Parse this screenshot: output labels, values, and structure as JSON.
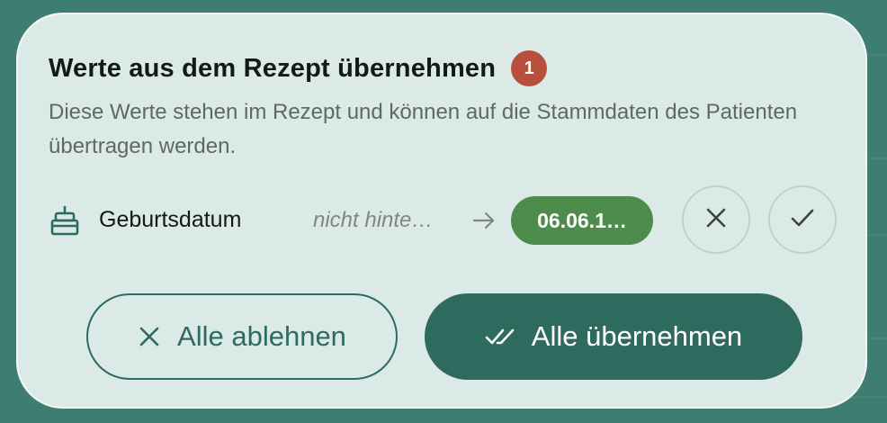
{
  "dialog": {
    "title": "Werte aus dem Rezept übernehmen",
    "badge_count": "1",
    "description": "Diese Werte stehen im Rezept und können auf die Stammdaten des Patienten übertragen werden."
  },
  "fields": [
    {
      "icon": "cake-icon",
      "label": "Geburtsdatum",
      "old_value": "nicht hinte…",
      "new_value": "06.06.1…"
    }
  ],
  "actions": {
    "reject_all_label": "Alle ablehnen",
    "accept_all_label": "Alle übernehmen"
  },
  "colors": {
    "background": "#3d7d72",
    "card": "#dceae7",
    "primary": "#2f6a5f",
    "badge": "#b9503e",
    "new_value_pill": "#4e8c4e"
  }
}
